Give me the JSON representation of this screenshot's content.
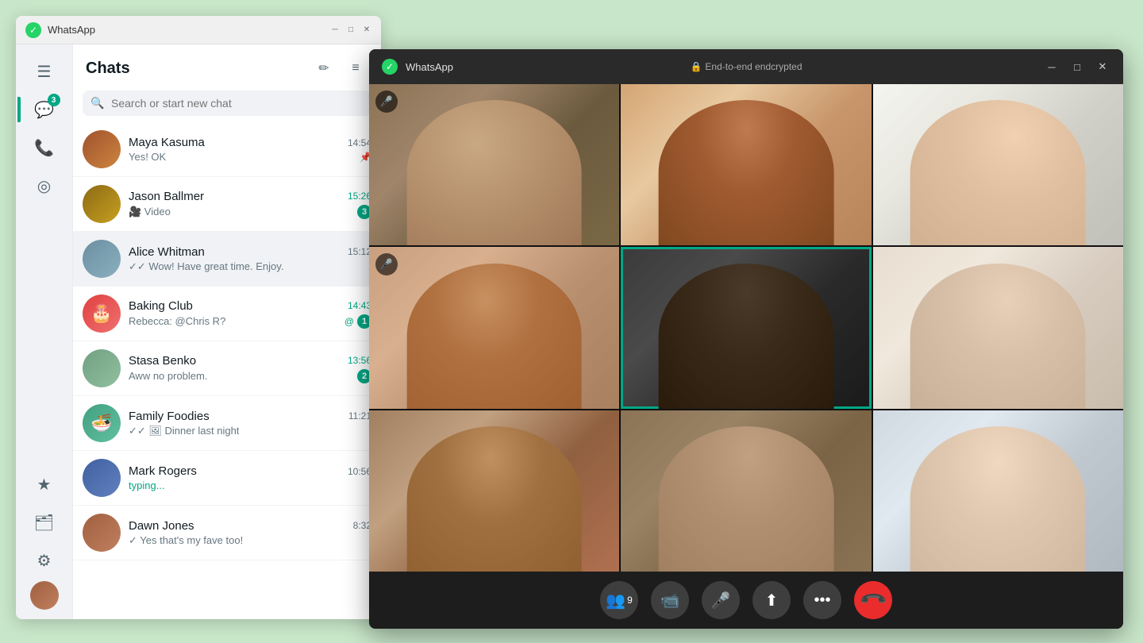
{
  "app": {
    "title": "WhatsApp",
    "encrypted_label": "End-to-end endcrypted"
  },
  "sidebar": {
    "badge": "3",
    "icons": {
      "menu": "☰",
      "chats": "💬",
      "calls": "📞",
      "status": "◎",
      "starred": "★",
      "archived": "🗂",
      "settings": "⚙"
    }
  },
  "chats": {
    "title": "Chats",
    "new_chat_icon": "✏",
    "filter_icon": "≡",
    "search_placeholder": "Search or start new chat",
    "items": [
      {
        "name": "Maya Kasuma",
        "time": "14:54",
        "preview": "Yes! OK",
        "pinned": true,
        "unread": 0,
        "time_color": "normal"
      },
      {
        "name": "Jason Ballmer",
        "time": "15:26",
        "preview": "🎥 Video",
        "pinned": false,
        "unread": 3,
        "time_color": "green"
      },
      {
        "name": "Alice Whitman",
        "time": "15:12",
        "preview": "✓✓ Wow! Have great time. Enjoy.",
        "pinned": false,
        "unread": 0,
        "time_color": "normal",
        "active": true
      },
      {
        "name": "Baking Club",
        "time": "14:43",
        "preview": "Rebecca: @Chris R?",
        "pinned": false,
        "unread": 1,
        "mention": true,
        "time_color": "green"
      },
      {
        "name": "Stasa Benko",
        "time": "13:56",
        "preview": "Aww no problem.",
        "pinned": false,
        "unread": 2,
        "time_color": "green"
      },
      {
        "name": "Family Foodies",
        "time": "11:21",
        "preview": "✓✓ 🖼 Dinner last night",
        "pinned": false,
        "unread": 0,
        "time_color": "normal"
      },
      {
        "name": "Mark Rogers",
        "time": "10:56",
        "preview": "typing...",
        "typing": true,
        "pinned": false,
        "unread": 0,
        "time_color": "normal"
      },
      {
        "name": "Dawn Jones",
        "time": "8:32",
        "preview": "✓ Yes that's my fave too!",
        "pinned": false,
        "unread": 0,
        "time_color": "normal"
      }
    ]
  },
  "call": {
    "participants_count": "9",
    "controls": {
      "participants": "👥",
      "video": "📹",
      "mic": "🎤",
      "screen": "⬆",
      "more": "•••",
      "end": "📞"
    }
  }
}
